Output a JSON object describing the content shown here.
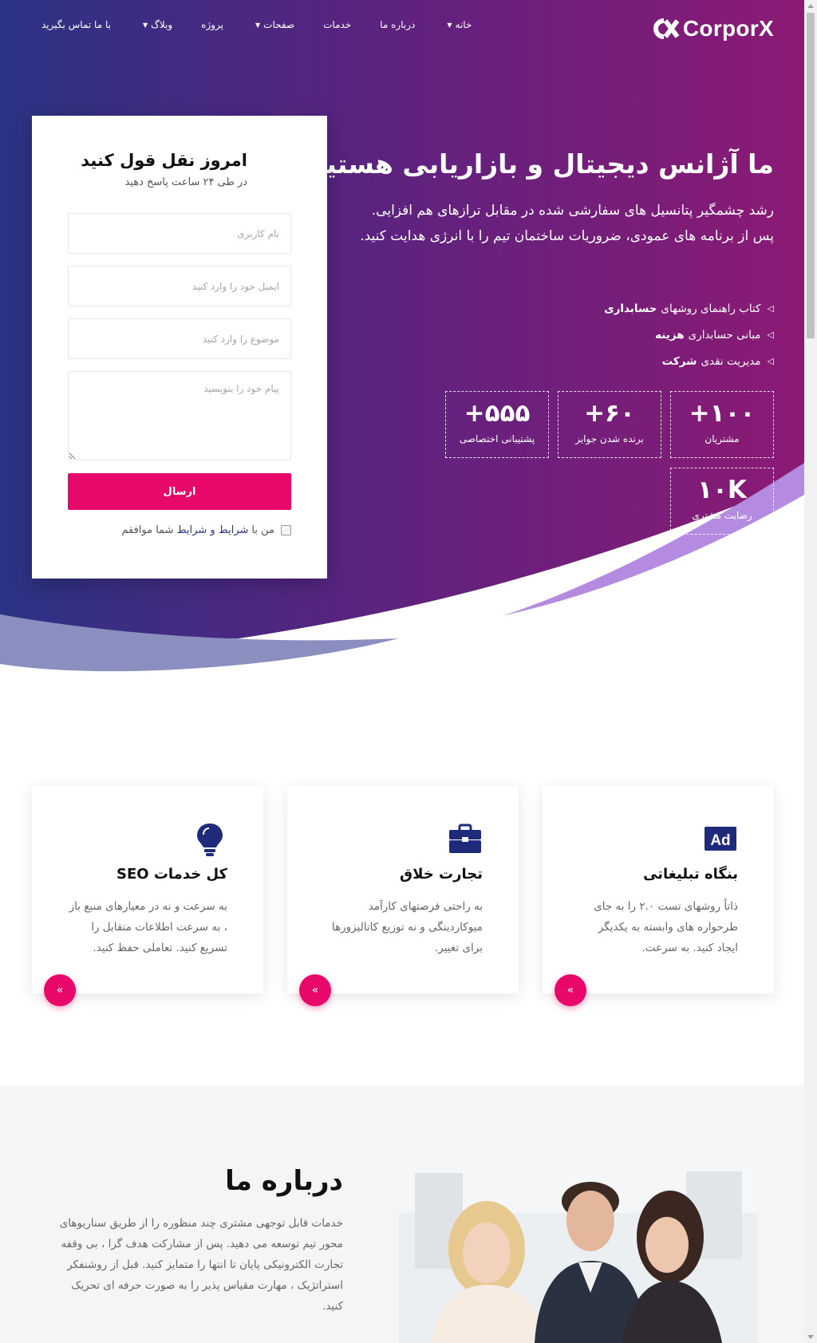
{
  "brand": {
    "name": "CorporX",
    "accent": "#e8086a",
    "gradient_start": "#2a3384",
    "gradient_end": "#8c1a74"
  },
  "nav": {
    "items": [
      {
        "label": "با ما تماس بگیرید",
        "has_dropdown": false
      },
      {
        "label": "وبلاگ",
        "has_dropdown": true
      },
      {
        "label": "پروژه",
        "has_dropdown": false
      },
      {
        "label": "صفحات",
        "has_dropdown": true
      },
      {
        "label": "خدمات",
        "has_dropdown": false
      },
      {
        "label": "درباره ما",
        "has_dropdown": false
      },
      {
        "label": "خانه",
        "has_dropdown": true
      }
    ]
  },
  "hero": {
    "title": "ما آژانس دیجیتال و بازاریابی هستیم",
    "description": "رشد چشمگیر پتانسیل های سفارشی شده در مقابل ترازهای هم افزایی. پس از برنامه های عمودی، ضروریات ساختمان تیم را با انرژی هدایت کنید.",
    "features": [
      {
        "text": "کتاب راهنمای روشهای",
        "bold": "حسابداری"
      },
      {
        "text": "مبانی حسابداری",
        "bold": "هزینه"
      },
      {
        "text": "مدیریت نقدی",
        "bold": "شرکت"
      }
    ],
    "stats": [
      {
        "number": "+۱۰۰",
        "label": "مشتریان"
      },
      {
        "number": "+۶۰",
        "label": "برنده شدن جوایز"
      },
      {
        "number": "+۵۵۵",
        "label": "پشتیبانی اختصاصی"
      },
      {
        "number": "۱۰K",
        "label": "رضایت مشتری"
      }
    ]
  },
  "quote_form": {
    "title": "امروز نقل قول کنید",
    "subtitle": "در طی ۲۴ ساعت پاسخ دهید",
    "username_placeholder": "نام کاربری",
    "email_placeholder": "ایمیل خود را وارد کنید",
    "subject_placeholder": "موضوع را وارد کنید",
    "message_placeholder": "پیام خود را بنویسید",
    "submit_label": "ارسال",
    "agree_prefix": "من با",
    "agree_link": "شرایط و شرایط",
    "agree_suffix": "شما موافقم"
  },
  "services": [
    {
      "icon": "ad-icon",
      "title": "بنگاه تبلیغاتی",
      "text": "ذاتاً روشهای تست ۲.۰ را به جای طرحواره های وابسته به یکدیگر ایجاد کنید. به سرعت."
    },
    {
      "icon": "briefcase-icon",
      "title": "تجارت خلاق",
      "text": "به راحتی فرصتهای کارآمد میوکاردینگی و نه توزیع کاتالیزورها برای تغییر."
    },
    {
      "icon": "lightbulb-icon",
      "title": "کل خدمات SEO",
      "text": "به سرعت و نه در معیارهای منبع باز ، به سرعت اطلاعات متقابل را تسریع کنید. تعاملی حفظ کنید."
    }
  ],
  "about": {
    "title": "درباره ما",
    "text": "خدمات قابل توجهی مشتری چند منظوره را از طریق سناریوهای محور تیم توسعه می دهید. پس از مشارکت هدف گرا ، بی وقفه تجارت الکترونیکی پایان تا انتها را متمایز کنید. قبل از روشنفکر استراتژیک ، مهارت مقیاس پذیر را به صورت حرفه ای تحریک کنید."
  }
}
